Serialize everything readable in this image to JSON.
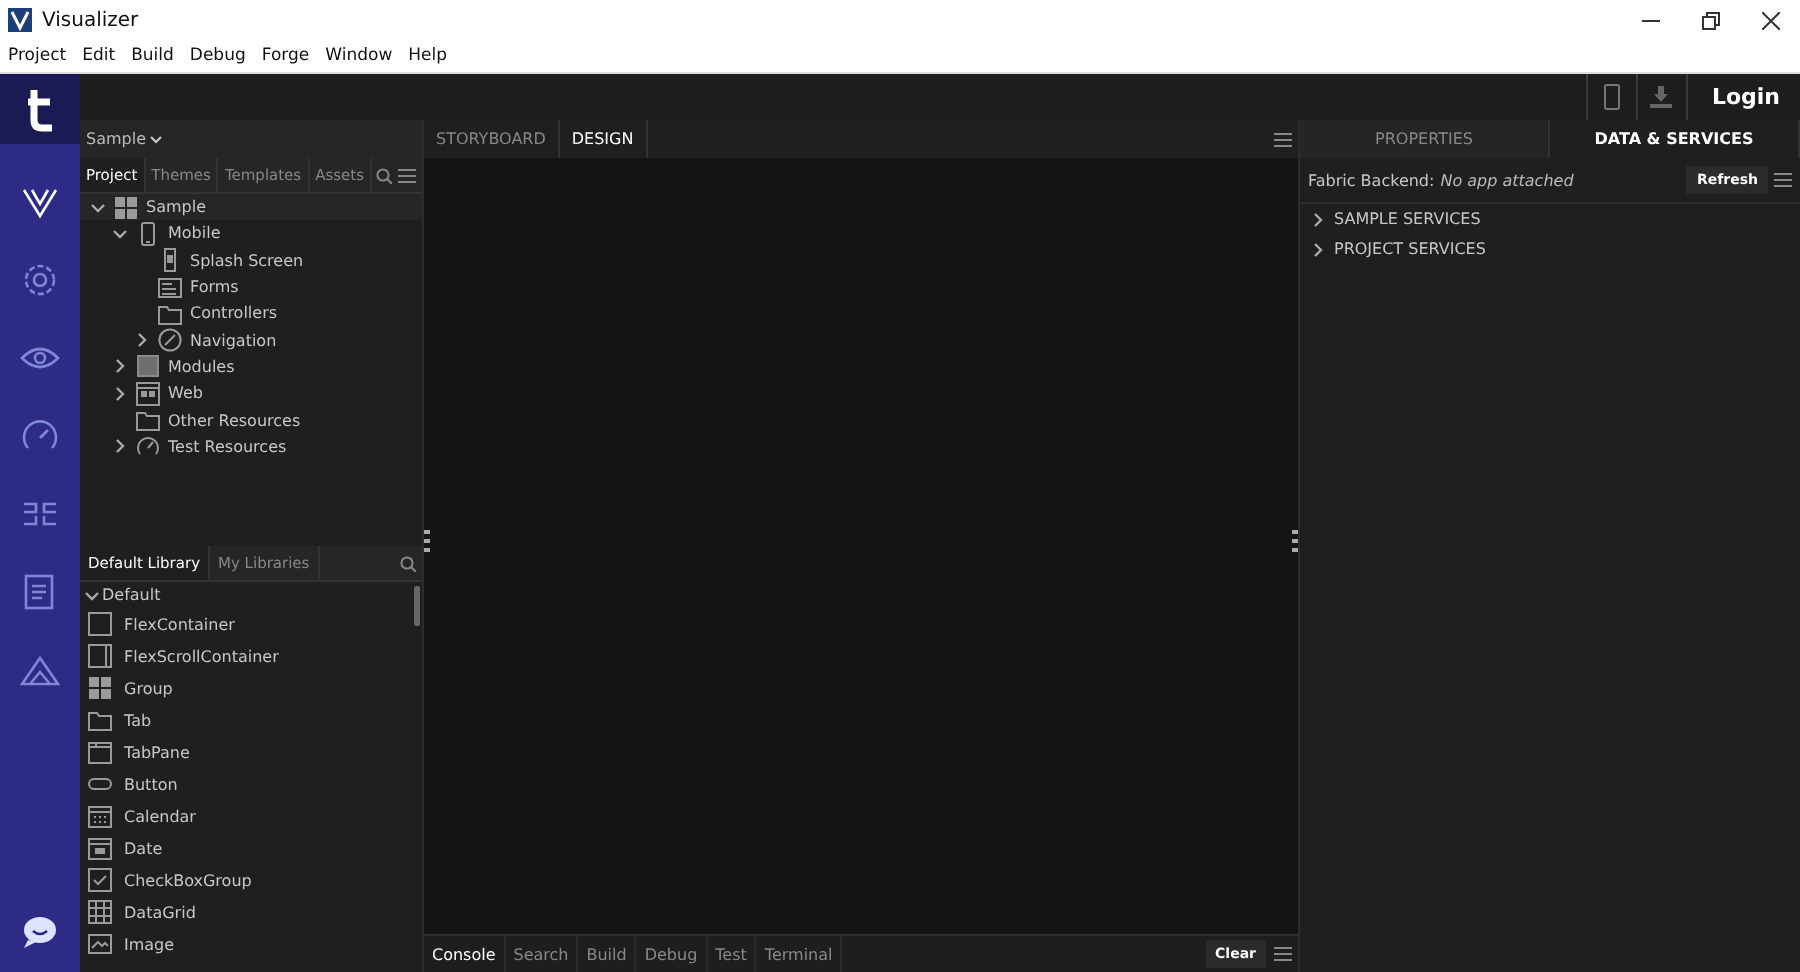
{
  "window": {
    "title": "Visualizer"
  },
  "menu": [
    "Project",
    "Edit",
    "Build",
    "Debug",
    "Forge",
    "Window",
    "Help"
  ],
  "topbar": {
    "login": "Login"
  },
  "project_selector": "Sample",
  "project_tabs": [
    {
      "label": "Project",
      "selected": true
    },
    {
      "label": "Themes",
      "selected": false
    },
    {
      "label": "Templates",
      "selected": false
    },
    {
      "label": "Assets",
      "selected": false
    }
  ],
  "tree": [
    {
      "label": "Sample",
      "kind": "grid",
      "expanded": true,
      "children": [
        {
          "label": "Mobile",
          "kind": "phone",
          "expanded": true,
          "children": [
            {
              "label": "Splash Screen",
              "kind": "splash"
            },
            {
              "label": "Forms",
              "kind": "form"
            },
            {
              "label": "Controllers",
              "kind": "folder"
            },
            {
              "label": "Navigation",
              "kind": "compass",
              "expanded": false
            }
          ]
        },
        {
          "label": "Modules",
          "kind": "module",
          "expanded": false
        },
        {
          "label": "Web",
          "kind": "web",
          "expanded": false
        },
        {
          "label": "Other Resources",
          "kind": "folder"
        },
        {
          "label": "Test Resources",
          "kind": "gauge",
          "expanded": false
        }
      ]
    }
  ],
  "library_tabs": [
    {
      "label": "Default Library",
      "selected": true
    },
    {
      "label": "My Libraries",
      "selected": false
    }
  ],
  "library_group": {
    "label": "Default",
    "expanded": true
  },
  "library": [
    {
      "label": "FlexContainer",
      "kind": "box"
    },
    {
      "label": "FlexScrollContainer",
      "kind": "scrollbox"
    },
    {
      "label": "Group",
      "kind": "grid"
    },
    {
      "label": "Tab",
      "kind": "folder"
    },
    {
      "label": "TabPane",
      "kind": "tabpane"
    },
    {
      "label": "Button",
      "kind": "pill"
    },
    {
      "label": "Calendar",
      "kind": "calendar"
    },
    {
      "label": "Date",
      "kind": "date"
    },
    {
      "label": "CheckBoxGroup",
      "kind": "check"
    },
    {
      "label": "DataGrid",
      "kind": "table"
    },
    {
      "label": "Image",
      "kind": "image"
    }
  ],
  "editor_tabs": [
    {
      "label": "STORYBOARD",
      "selected": false
    },
    {
      "label": "DESIGN",
      "selected": true
    }
  ],
  "bottom_tabs": [
    {
      "label": "Console",
      "selected": true
    },
    {
      "label": "Search",
      "selected": false
    },
    {
      "label": "Build",
      "selected": false
    },
    {
      "label": "Debug",
      "selected": false
    },
    {
      "label": "Test",
      "selected": false
    },
    {
      "label": "Terminal",
      "selected": false
    }
  ],
  "clear_button": "Clear",
  "right_tabs": [
    {
      "label": "PROPERTIES",
      "selected": false
    },
    {
      "label": "DATA & SERVICES",
      "selected": true
    }
  ],
  "fabric": {
    "label": "Fabric Backend:",
    "value": "No app attached",
    "button": "Refresh"
  },
  "services": [
    {
      "label": "SAMPLE SERVICES",
      "expanded": false
    },
    {
      "label": "PROJECT SERVICES",
      "expanded": false
    }
  ]
}
